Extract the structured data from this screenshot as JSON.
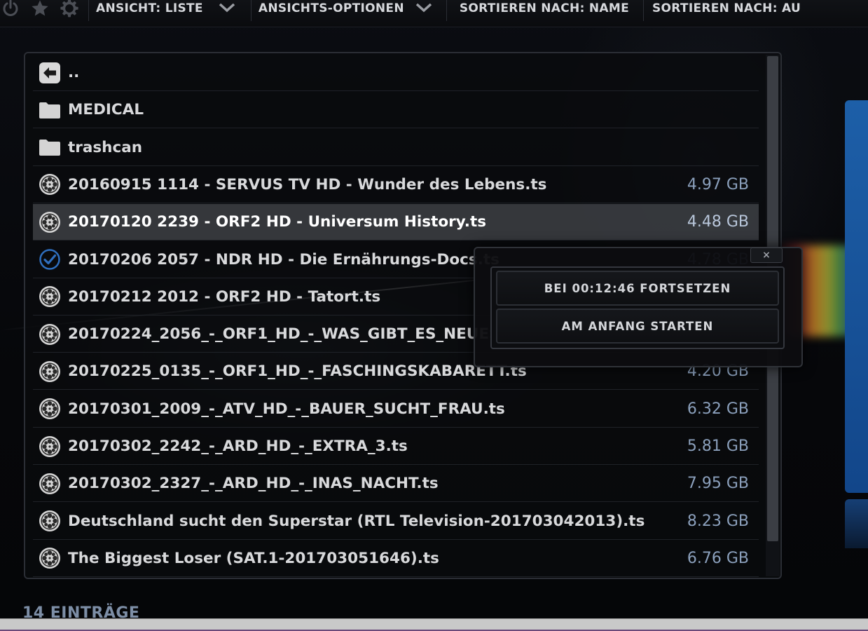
{
  "topbar": {
    "icons": [
      "power-icon",
      "star-icon",
      "gear-icon"
    ],
    "view_label": "ANSICHT: LISTE",
    "view_options_label": "ANSICHTS-OPTIONEN",
    "sort_by_label": "SORTIEREN NACH: NAME",
    "sort_order_label": "SORTIEREN NACH: AU"
  },
  "file_list": {
    "items": [
      {
        "label": "..",
        "size": "",
        "icon": "back-arrow-icon"
      },
      {
        "label": "MEDICAL",
        "size": "",
        "icon": "folder-icon"
      },
      {
        "label": "trashcan",
        "size": "",
        "icon": "folder-icon"
      },
      {
        "label": "20160915 1114 - SERVUS TV HD - Wunder des Lebens.ts",
        "size": "4.97 GB",
        "icon": "film-reel-icon"
      },
      {
        "label": "20170120 2239 - ORF2 HD - Universum History.ts",
        "size": "4.48 GB",
        "icon": "film-reel-icon"
      },
      {
        "label": "20170206 2057 - NDR HD - Die Ernährungs-Docs.ts",
        "size": "4.78 GB",
        "icon": "watched-check-icon"
      },
      {
        "label": "20170212 2012 - ORF2 HD - Tatort.ts",
        "size": "",
        "icon": "film-reel-icon"
      },
      {
        "label": "20170224_2056_-_ORF1_HD_-_WAS_GIBT_ES_NEUES_.ts",
        "size": "",
        "icon": "film-reel-icon"
      },
      {
        "label": "20170225_0135_-_ORF1_HD_-_FASCHINGSKABARETT.ts",
        "size": "4.20 GB",
        "icon": "film-reel-icon"
      },
      {
        "label": "20170301_2009_-_ATV_HD_-_BAUER_SUCHT_FRAU.ts",
        "size": "6.32 GB",
        "icon": "film-reel-icon"
      },
      {
        "label": "20170302_2242_-_ARD_HD_-_EXTRA_3.ts",
        "size": "5.81 GB",
        "icon": "film-reel-icon"
      },
      {
        "label": "20170302_2327_-_ARD_HD_-_INAS_NACHT.ts",
        "size": "7.95 GB",
        "icon": "film-reel-icon"
      },
      {
        "label": "Deutschland sucht den Superstar (RTL Television-201703042013).ts",
        "size": "8.23 GB",
        "icon": "film-reel-icon"
      },
      {
        "label": "The Biggest Loser (SAT.1-201703051646).ts",
        "size": "6.76 GB",
        "icon": "film-reel-icon"
      }
    ],
    "selected_index": 4
  },
  "footer": {
    "item_count": "14 EINTRÄGE"
  },
  "resume_dialog": {
    "close_label": "×",
    "resume_label": "BEI 00:12:46 FORTSETZEN",
    "start_label": "AM ANFANG STARTEN"
  },
  "colors": {
    "accent_blue": "#1d5fa8",
    "size_text": "#8ba0bc",
    "footer_text": "#7d8ea6"
  }
}
